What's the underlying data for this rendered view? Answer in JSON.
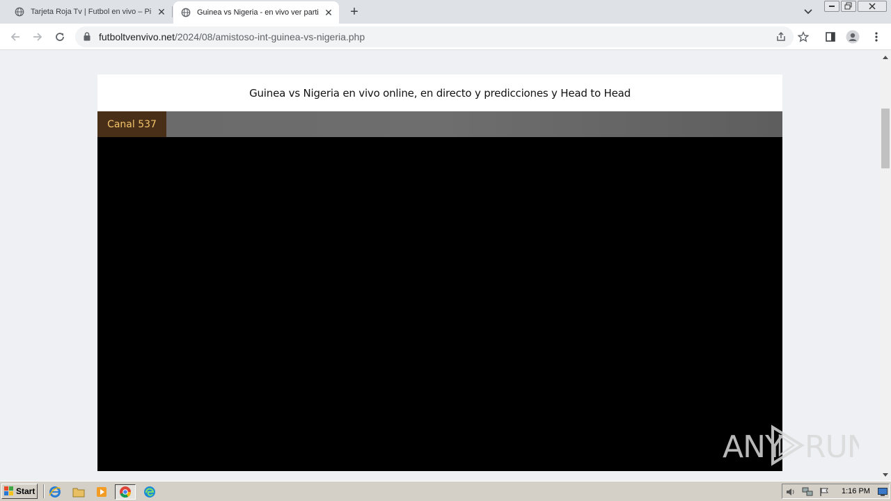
{
  "browser": {
    "tabs": [
      {
        "title": "Tarjeta Roja Tv | Futbol en vivo – Pirlo",
        "active": false
      },
      {
        "title": "Guinea vs Nigeria - en vivo ver partido",
        "active": true
      }
    ],
    "new_tab_label": "+",
    "url": {
      "host": "futboltvenvivo.net",
      "path": "/2024/08/amistoso-int-guinea-vs-nigeria.php"
    }
  },
  "page": {
    "heading": "Guinea vs Nigeria en vivo online, en directo y predicciones y Head to Head",
    "channel_button": "Canal 537",
    "watermark": "ANY RUN"
  },
  "taskbar": {
    "start_label": "Start",
    "clock": "1:16 PM"
  },
  "colors": {
    "channel_bg": "#4a2f18",
    "channel_text": "#f2c46a",
    "player_bg": "#000000",
    "page_bg": "#eef0f4"
  }
}
